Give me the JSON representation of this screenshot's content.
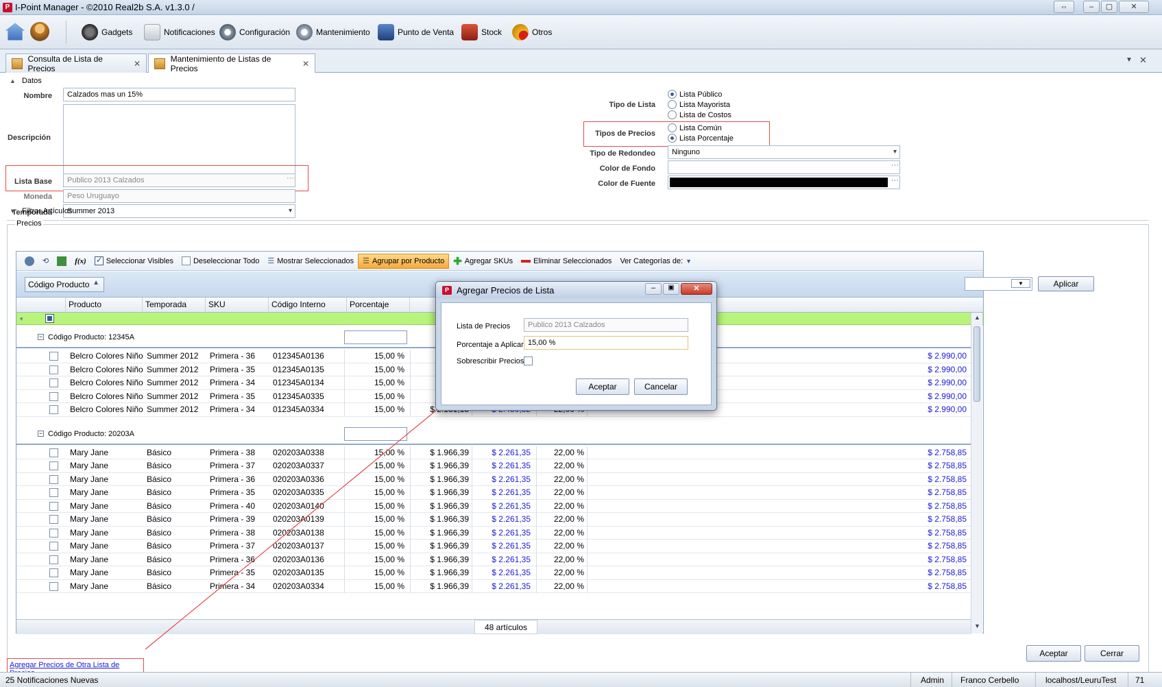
{
  "window": {
    "title": "I-Point Manager - ©2010 Real2b S.A. v1.3.0 /"
  },
  "toolbar": {
    "items": [
      "Gadgets",
      "Notificaciones",
      "Configuración",
      "Mantenimiento",
      "Punto de Venta",
      "Stock",
      "Otros"
    ]
  },
  "tabs": [
    {
      "label": "Consulta de Lista de Precios",
      "active": false
    },
    {
      "label": "Mantenimiento de Listas de Precios",
      "active": true
    }
  ],
  "datos": {
    "section": "Datos",
    "nombre_label": "Nombre",
    "nombre": "Calzados mas un 15%",
    "descripcion_label": "Descripción",
    "lista_base_label": "Lista Base",
    "lista_base": "Publico 2013 Calzados",
    "moneda_label": "Moneda",
    "moneda": "Peso Uruguayo",
    "temporada_label": "Temporada",
    "temporada": "Summer 2013",
    "tipo_lista_label": "Tipo de Lista",
    "tipo_lista": [
      "Lista Público",
      "Lista Mayorista",
      "Lista de Costos"
    ],
    "tipos_precios_label": "Tipos de Precios",
    "tipos_precios": [
      "Lista Común",
      "Lista Porcentaje"
    ],
    "redondeo_label": "Tipo de Redondeo",
    "redondeo": "Ninguno",
    "color_fondo_label": "Color de Fondo",
    "color_fuente_label": "Color de Fuente",
    "filtrar": "Filtrar Artículos",
    "precios": "Precios"
  },
  "grid_toolbar": {
    "seleccionar": "Seleccionar Visibles",
    "deseleccionar": "Deseleccionar Todo",
    "mostrar": "Mostrar Seleccionados",
    "agrupar": "Agrupar por Producto",
    "agregar_skus": "Agregar SKUs",
    "eliminar": "Eliminar Seleccionados",
    "categorias": "Ver Categorías de:"
  },
  "grid": {
    "group_chip": "Código Producto",
    "aplicar": "Aplicar",
    "columns": [
      "Producto",
      "Temporada",
      "SKU",
      "Código Interno",
      "Porcentaje"
    ],
    "groups": [
      {
        "title": "Código Producto: 12345A",
        "rows": [
          [
            "Belcro Colores Niño",
            "Summer 2012",
            "Primera - 36",
            "012345A0136",
            "15,00 %",
            "",
            "",
            "",
            "$ 2.990,00"
          ],
          [
            "Belcro Colores Niño",
            "Summer 2012",
            "Primera - 35",
            "012345A0135",
            "15,00 %",
            "",
            "",
            "",
            "$ 2.990,00"
          ],
          [
            "Belcro Colores Niño",
            "Summer 2012",
            "Primera - 34",
            "012345A0134",
            "15,00 %",
            "",
            "",
            "",
            "$ 2.990,00"
          ],
          [
            "Belcro Colores Niño",
            "Summer 2012",
            "Primera - 35",
            "012345A0335",
            "15,00 %",
            "",
            "",
            "",
            "$ 2.990,00"
          ],
          [
            "Belcro Colores Niño",
            "Summer 2012",
            "Primera - 34",
            "012345A0334",
            "15,00 %",
            "$ 2.131,15",
            "$ 2.450,82",
            "22,00 %",
            "$ 2.990,00"
          ]
        ]
      },
      {
        "title": "Código Producto: 20203A",
        "rows": [
          [
            "Mary Jane",
            "Básico",
            "Primera - 38",
            "020203A0338",
            "15,00 %",
            "$ 1.966,39",
            "$ 2.261,35",
            "22,00 %",
            "$ 2.758,85"
          ],
          [
            "Mary Jane",
            "Básico",
            "Primera - 37",
            "020203A0337",
            "15,00 %",
            "$ 1.966,39",
            "$ 2.261,35",
            "22,00 %",
            "$ 2.758,85"
          ],
          [
            "Mary Jane",
            "Básico",
            "Primera - 36",
            "020203A0336",
            "15,00 %",
            "$ 1.966,39",
            "$ 2.261,35",
            "22,00 %",
            "$ 2.758,85"
          ],
          [
            "Mary Jane",
            "Básico",
            "Primera - 35",
            "020203A0335",
            "15,00 %",
            "$ 1.966,39",
            "$ 2.261,35",
            "22,00 %",
            "$ 2.758,85"
          ],
          [
            "Mary Jane",
            "Básico",
            "Primera - 40",
            "020203A0140",
            "15,00 %",
            "$ 1.966,39",
            "$ 2.261,35",
            "22,00 %",
            "$ 2.758,85"
          ],
          [
            "Mary Jane",
            "Básico",
            "Primera - 39",
            "020203A0139",
            "15,00 %",
            "$ 1.966,39",
            "$ 2.261,35",
            "22,00 %",
            "$ 2.758,85"
          ],
          [
            "Mary Jane",
            "Básico",
            "Primera - 38",
            "020203A0138",
            "15,00 %",
            "$ 1.966,39",
            "$ 2.261,35",
            "22,00 %",
            "$ 2.758,85"
          ],
          [
            "Mary Jane",
            "Básico",
            "Primera - 37",
            "020203A0137",
            "15,00 %",
            "$ 1.966,39",
            "$ 2.261,35",
            "22,00 %",
            "$ 2.758,85"
          ],
          [
            "Mary Jane",
            "Básico",
            "Primera - 36",
            "020203A0136",
            "15,00 %",
            "$ 1.966,39",
            "$ 2.261,35",
            "22,00 %",
            "$ 2.758,85"
          ],
          [
            "Mary Jane",
            "Básico",
            "Primera - 35",
            "020203A0135",
            "15,00 %",
            "$ 1.966,39",
            "$ 2.261,35",
            "22,00 %",
            "$ 2.758,85"
          ],
          [
            "Mary Jane",
            "Básico",
            "Primera - 34",
            "020203A0334",
            "15,00 %",
            "$ 1.966,39",
            "$ 2.261,35",
            "22,00 %",
            "$ 2.758,85"
          ]
        ]
      }
    ],
    "count": "48 artículos"
  },
  "link": "Agregar Precios de Otra Lista de Precios",
  "buttons": {
    "aceptar": "Aceptar",
    "cerrar": "Cerrar"
  },
  "dialog": {
    "title": "Agregar Precios de Lista",
    "lista_label": "Lista de Precios",
    "lista": "Publico 2013 Calzados",
    "porcentaje_label": "Porcentaje a Aplicar",
    "porcentaje": "15,00 %",
    "sobrescribir_label": "Sobrescribir Precios",
    "aceptar": "Aceptar",
    "cancelar": "Cancelar"
  },
  "status": {
    "notificaciones": "25 Notificaciones Nuevas",
    "rol": "Admin",
    "usuario": "Franco Cerbello",
    "servidor": "localhost/LeuruTest",
    "numero": "71"
  }
}
